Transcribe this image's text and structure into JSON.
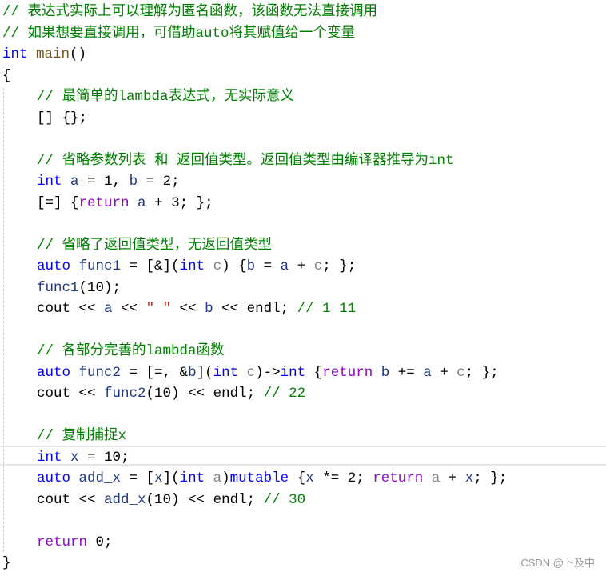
{
  "editor": {
    "lines": [
      {
        "indent": false,
        "tokens": [
          {
            "t": "// 表达式实际上可以理解为匿名函数，该函数无法直接调用",
            "k": "comment"
          }
        ]
      },
      {
        "indent": false,
        "tokens": [
          {
            "t": "// 如果想要直接调用，可借助auto将其赋值给一个变量",
            "k": "comment"
          }
        ]
      },
      {
        "indent": false,
        "tokens": [
          {
            "t": "int",
            "k": "kw"
          },
          {
            "t": " ",
            "k": "op"
          },
          {
            "t": "main",
            "k": "fn"
          },
          {
            "t": "()",
            "k": "op"
          }
        ]
      },
      {
        "indent": false,
        "tokens": [
          {
            "t": "{",
            "k": "op"
          }
        ]
      },
      {
        "indent": true,
        "tokens": [
          {
            "t": "// 最简单的lambda表达式，无实际意义",
            "k": "comment"
          }
        ]
      },
      {
        "indent": true,
        "tokens": [
          {
            "t": "[] {};",
            "k": "op"
          }
        ]
      },
      {
        "indent": true,
        "tokens": []
      },
      {
        "indent": true,
        "tokens": [
          {
            "t": "// 省略参数列表 和 返回值类型。返回值类型由编译器推导为int",
            "k": "comment"
          }
        ]
      },
      {
        "indent": true,
        "tokens": [
          {
            "t": "int",
            "k": "kw"
          },
          {
            "t": " ",
            "k": "op"
          },
          {
            "t": "a",
            "k": "var"
          },
          {
            "t": " = 1, ",
            "k": "op"
          },
          {
            "t": "b",
            "k": "var"
          },
          {
            "t": " = 2;",
            "k": "op"
          }
        ]
      },
      {
        "indent": true,
        "tokens": [
          {
            "t": "[=] {",
            "k": "op"
          },
          {
            "t": "return",
            "k": "ctrl"
          },
          {
            "t": " ",
            "k": "op"
          },
          {
            "t": "a",
            "k": "var"
          },
          {
            "t": " + 3; };",
            "k": "op"
          }
        ]
      },
      {
        "indent": true,
        "tokens": []
      },
      {
        "indent": true,
        "tokens": [
          {
            "t": "// 省略了返回值类型，无返回值类型",
            "k": "comment"
          }
        ]
      },
      {
        "indent": true,
        "tokens": [
          {
            "t": "auto",
            "k": "kw"
          },
          {
            "t": " ",
            "k": "op"
          },
          {
            "t": "func1",
            "k": "var"
          },
          {
            "t": " = [&](",
            "k": "op"
          },
          {
            "t": "int",
            "k": "kw"
          },
          {
            "t": " ",
            "k": "op"
          },
          {
            "t": "c",
            "k": "param"
          },
          {
            "t": ") {",
            "k": "op"
          },
          {
            "t": "b",
            "k": "var"
          },
          {
            "t": " = ",
            "k": "op"
          },
          {
            "t": "a",
            "k": "var"
          },
          {
            "t": " + ",
            "k": "op"
          },
          {
            "t": "c",
            "k": "param"
          },
          {
            "t": "; };",
            "k": "op"
          }
        ]
      },
      {
        "indent": true,
        "tokens": [
          {
            "t": "func1",
            "k": "var"
          },
          {
            "t": "(10);",
            "k": "op"
          }
        ]
      },
      {
        "indent": true,
        "tokens": [
          {
            "t": "cout",
            "k": "stream"
          },
          {
            "t": " << ",
            "k": "op"
          },
          {
            "t": "a",
            "k": "var"
          },
          {
            "t": " << ",
            "k": "op"
          },
          {
            "t": "\" \"",
            "k": "str"
          },
          {
            "t": " << ",
            "k": "op"
          },
          {
            "t": "b",
            "k": "var"
          },
          {
            "t": " << ",
            "k": "op"
          },
          {
            "t": "endl",
            "k": "stream"
          },
          {
            "t": "; ",
            "k": "op"
          },
          {
            "t": "// 1 11",
            "k": "comment"
          }
        ]
      },
      {
        "indent": true,
        "tokens": []
      },
      {
        "indent": true,
        "tokens": [
          {
            "t": "// 各部分完善的lambda函数",
            "k": "comment"
          }
        ]
      },
      {
        "indent": true,
        "tokens": [
          {
            "t": "auto",
            "k": "kw"
          },
          {
            "t": " ",
            "k": "op"
          },
          {
            "t": "func2",
            "k": "var"
          },
          {
            "t": " = [=, &",
            "k": "op"
          },
          {
            "t": "b",
            "k": "var"
          },
          {
            "t": "](",
            "k": "op"
          },
          {
            "t": "int",
            "k": "kw"
          },
          {
            "t": " ",
            "k": "op"
          },
          {
            "t": "c",
            "k": "param"
          },
          {
            "t": ")->",
            "k": "op"
          },
          {
            "t": "int",
            "k": "kw"
          },
          {
            "t": " {",
            "k": "op"
          },
          {
            "t": "return",
            "k": "ctrl"
          },
          {
            "t": " ",
            "k": "op"
          },
          {
            "t": "b",
            "k": "var"
          },
          {
            "t": " += ",
            "k": "op"
          },
          {
            "t": "a",
            "k": "var"
          },
          {
            "t": " + ",
            "k": "op"
          },
          {
            "t": "c",
            "k": "param"
          },
          {
            "t": "; };",
            "k": "op"
          }
        ]
      },
      {
        "indent": true,
        "tokens": [
          {
            "t": "cout",
            "k": "stream"
          },
          {
            "t": " << ",
            "k": "op"
          },
          {
            "t": "func2",
            "k": "var"
          },
          {
            "t": "(10) << ",
            "k": "op"
          },
          {
            "t": "endl",
            "k": "stream"
          },
          {
            "t": "; ",
            "k": "op"
          },
          {
            "t": "// 22",
            "k": "comment"
          }
        ]
      },
      {
        "indent": true,
        "tokens": []
      },
      {
        "indent": true,
        "tokens": [
          {
            "t": "// 复制捕捉x",
            "k": "comment"
          }
        ]
      },
      {
        "indent": true,
        "current": true,
        "tokens": [
          {
            "t": "int",
            "k": "kw"
          },
          {
            "t": " ",
            "k": "op"
          },
          {
            "t": "x",
            "k": "var"
          },
          {
            "t": " = 10;",
            "k": "op"
          }
        ]
      },
      {
        "indent": true,
        "tokens": [
          {
            "t": "auto",
            "k": "kw"
          },
          {
            "t": " ",
            "k": "op"
          },
          {
            "t": "add_x",
            "k": "var"
          },
          {
            "t": " = [",
            "k": "op"
          },
          {
            "t": "x",
            "k": "var"
          },
          {
            "t": "](",
            "k": "op"
          },
          {
            "t": "int",
            "k": "kw"
          },
          {
            "t": " ",
            "k": "op"
          },
          {
            "t": "a",
            "k": "param"
          },
          {
            "t": ")",
            "k": "op"
          },
          {
            "t": "mutable",
            "k": "kw"
          },
          {
            "t": " {",
            "k": "op"
          },
          {
            "t": "x",
            "k": "var"
          },
          {
            "t": " *= 2; ",
            "k": "op"
          },
          {
            "t": "return",
            "k": "ctrl"
          },
          {
            "t": " ",
            "k": "op"
          },
          {
            "t": "a",
            "k": "param"
          },
          {
            "t": " + ",
            "k": "op"
          },
          {
            "t": "x",
            "k": "var"
          },
          {
            "t": "; };",
            "k": "op"
          }
        ]
      },
      {
        "indent": true,
        "tokens": [
          {
            "t": "cout",
            "k": "stream"
          },
          {
            "t": " << ",
            "k": "op"
          },
          {
            "t": "add_x",
            "k": "var"
          },
          {
            "t": "(10) << ",
            "k": "op"
          },
          {
            "t": "endl",
            "k": "stream"
          },
          {
            "t": "; ",
            "k": "op"
          },
          {
            "t": "// 30",
            "k": "comment"
          }
        ]
      },
      {
        "indent": true,
        "tokens": []
      },
      {
        "indent": true,
        "tokens": [
          {
            "t": "return",
            "k": "ctrl"
          },
          {
            "t": " 0;",
            "k": "op"
          }
        ]
      },
      {
        "indent": false,
        "tokens": [
          {
            "t": "}",
            "k": "op"
          }
        ]
      }
    ]
  },
  "watermark": "CSDN @卜及中"
}
